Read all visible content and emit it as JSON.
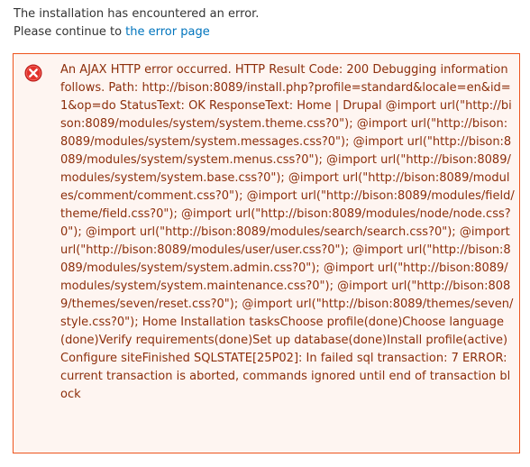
{
  "intro": {
    "line1": "The installation has encountered an error.",
    "line2_prefix": "Please continue to ",
    "link_label": "the error page"
  },
  "error": {
    "icon": "error-x-icon",
    "message": "An AJAX HTTP error occurred. HTTP Result Code: 200 Debugging information follows. Path: http://bison:8089/install.php?profile=standard&locale=en&id=1&op=do StatusText: OK ResponseText: Home | Drupal @import url(\"http://bison:8089/modules/system/system.theme.css?0\"); @import url(\"http://bison:8089/modules/system/system.messages.css?0\"); @import url(\"http://bison:8089/modules/system/system.menus.css?0\"); @import url(\"http://bison:8089/modules/system/system.base.css?0\"); @import url(\"http://bison:8089/modules/comment/comment.css?0\"); @import url(\"http://bison:8089/modules/field/theme/field.css?0\"); @import url(\"http://bison:8089/modules/node/node.css?0\"); @import url(\"http://bison:8089/modules/search/search.css?0\"); @import url(\"http://bison:8089/modules/user/user.css?0\"); @import url(\"http://bison:8089/modules/system/system.admin.css?0\"); @import url(\"http://bison:8089/modules/system/system.maintenance.css?0\"); @import url(\"http://bison:8089/themes/seven/reset.css?0\"); @import url(\"http://bison:8089/themes/seven/style.css?0\"); Home Installation tasksChoose profile(done)Choose language(done)Verify requirements(done)Set up database(done)Install profile(active)Configure siteFinished SQLSTATE[25P02]: In failed sql transaction: 7 ERROR: current transaction is aborted, commands ignored until end of transaction block"
  },
  "colors": {
    "link": "#0074bd",
    "error_border": "#ed541d",
    "error_background": "#fef5f1",
    "error_text": "#8c2e0b",
    "icon_red": "#e2322c"
  }
}
